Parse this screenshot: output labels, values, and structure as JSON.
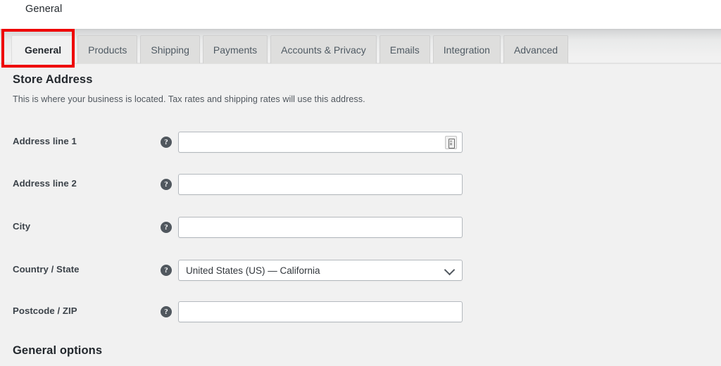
{
  "header": {
    "breadcrumb": "General"
  },
  "tabs": [
    {
      "label": "General",
      "name": "tab-general",
      "active": true
    },
    {
      "label": "Products",
      "name": "tab-products",
      "active": false
    },
    {
      "label": "Shipping",
      "name": "tab-shipping",
      "active": false
    },
    {
      "label": "Payments",
      "name": "tab-payments",
      "active": false
    },
    {
      "label": "Accounts & Privacy",
      "name": "tab-accounts-privacy",
      "active": false
    },
    {
      "label": "Emails",
      "name": "tab-emails",
      "active": false
    },
    {
      "label": "Integration",
      "name": "tab-integration",
      "active": false
    },
    {
      "label": "Advanced",
      "name": "tab-advanced",
      "active": false
    }
  ],
  "annotation": {
    "target": "General tab",
    "color": "#ee0000"
  },
  "store_address": {
    "title": "Store Address",
    "description": "This is where your business is located. Tax rates and shipping rates will use this address.",
    "fields": [
      {
        "label": "Address line 1",
        "value": "",
        "placeholder": "",
        "type": "text",
        "name": "address-line-1",
        "help": "?",
        "autofill_icon": true
      },
      {
        "label": "Address line 2",
        "value": "",
        "placeholder": "",
        "type": "text",
        "name": "address-line-2",
        "help": "?",
        "autofill_icon": false
      },
      {
        "label": "City",
        "value": "",
        "placeholder": "",
        "type": "text",
        "name": "city",
        "help": "?",
        "autofill_icon": false
      },
      {
        "label": "Country / State",
        "value": "United States (US) — California",
        "placeholder": "",
        "type": "select",
        "name": "country-state",
        "help": "?",
        "autofill_icon": false
      },
      {
        "label": "Postcode / ZIP",
        "value": "",
        "placeholder": "",
        "type": "text",
        "name": "postcode-zip",
        "help": "?",
        "autofill_icon": false
      }
    ]
  },
  "general_options": {
    "title": "General options"
  },
  "colors": {
    "body_bg": "#f1f1f1",
    "header_bg": "#ffffff",
    "tab_inactive": "#dededd",
    "tab_active": "#f1f1f1",
    "annotation_red": "#ee0000",
    "text_dark": "#23282d",
    "input_border": "#b4b9be"
  }
}
